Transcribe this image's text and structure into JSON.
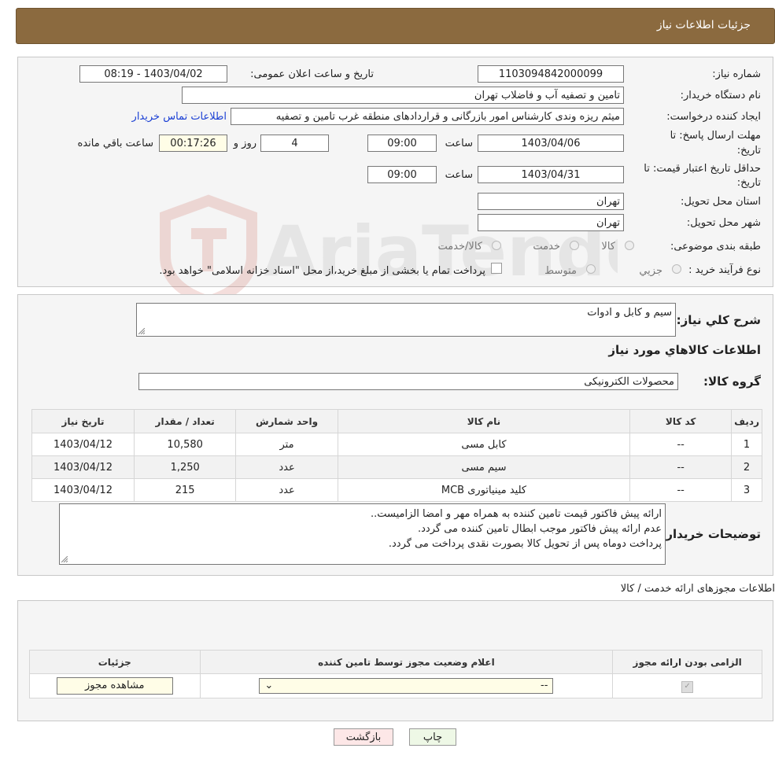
{
  "header": {
    "title": "جزئیات اطلاعات نیاز"
  },
  "form": {
    "need_number_label": "شماره نیاز:",
    "need_number": "1103094842000099",
    "announce_label": "تاریخ و ساعت اعلان عمومی:",
    "announce_value": "1403/04/02 - 08:19",
    "buyer_org_label": "نام دستگاه خریدار:",
    "buyer_org": "تامین و تصفیه آب و فاضلاب تهران",
    "requester_label": "ایجاد کننده درخواست:",
    "requester": "میثم ریزه وندی کارشناس امور بازرگانی و قراردادهای منطقه غرب تامین و تصفیه",
    "contact_link": "اطلاعات تماس خریدار",
    "deadline_label": "مهلت ارسال پاسخ: تا",
    "deadline_label2": "تاریخ:",
    "deadline_date": "1403/04/06",
    "time_label": "ساعت",
    "deadline_time": "09:00",
    "days_value": "4",
    "days_label": "روز و",
    "remaining_time": "00:17:26",
    "remaining_label": "ساعت باقي مانده",
    "validity_label": "حداقل تاریخ اعتبار قیمت: تا",
    "validity_label2": "تاریخ:",
    "validity_date": "1403/04/31",
    "validity_time": "09:00",
    "province_label": "استان محل تحویل:",
    "province": "تهران",
    "city_label": "شهر محل تحویل:",
    "city": "تهران",
    "category_label": "طبقه بندی موضوعی:",
    "category_options": [
      "کالا",
      "خدمت",
      "کالا/خدمت"
    ],
    "process_label": "نوع فرآیند خرید :",
    "process_options": [
      "جزيي",
      "متوسط"
    ],
    "process_note": "پرداخت تمام یا بخشی از مبلغ خرید،از محل \"اسناد خزانه اسلامی\" خواهد بود."
  },
  "summary": {
    "desc_label": "شرح کلي نياز:",
    "desc_value": "سیم و کابل و ادوات",
    "items_title": "اطلاعات کالاهاي مورد نياز",
    "group_label": "گروه کالا:",
    "group_value": "محصولات الکترونیکی"
  },
  "items_table": {
    "headers": [
      "رديف",
      "کد کالا",
      "نام کالا",
      "واحد شمارش",
      "تعداد / مقدار",
      "تاریخ نیاز"
    ],
    "rows": [
      [
        "1",
        "--",
        "کابل مسی",
        "متر",
        "10,580",
        "1403/04/12"
      ],
      [
        "2",
        "--",
        "سیم مسی",
        "عدد",
        "1,250",
        "1403/04/12"
      ],
      [
        "3",
        "--",
        "کلید مینیاتوری MCB",
        "عدد",
        "215",
        "1403/04/12"
      ]
    ]
  },
  "buyer_notes": {
    "label": "توضیحات خریدار:",
    "lines": [
      "ارائه پیش فاکتور قیمت تامین کننده به همراه مهر و امضا الزامیست..",
      "عدم ارائه پیش فاکتور موجب ابطال تامین کننده می گردد.",
      "پرداخت دوماه پس از تحویل کالا بصورت نقدی پرداخت می گردد."
    ]
  },
  "permits": {
    "title": "اطلاعات مجوزهای ارائه خدمت / کالا",
    "headers": [
      "الزامی بودن ارائه مجوز",
      "اعلام وضعیت مجوز توسط تامین کننده",
      "جزئیات"
    ],
    "select_value": "--",
    "view_button": "مشاهده مجوز"
  },
  "watermark": {
    "text": "AriaTender.neT"
  },
  "buttons": {
    "print": "چاپ",
    "back": "بازگشت"
  },
  "colors": {
    "header": "#8b6a3f",
    "back_button": "#fde7e7",
    "print_button": "#eef8e6"
  }
}
